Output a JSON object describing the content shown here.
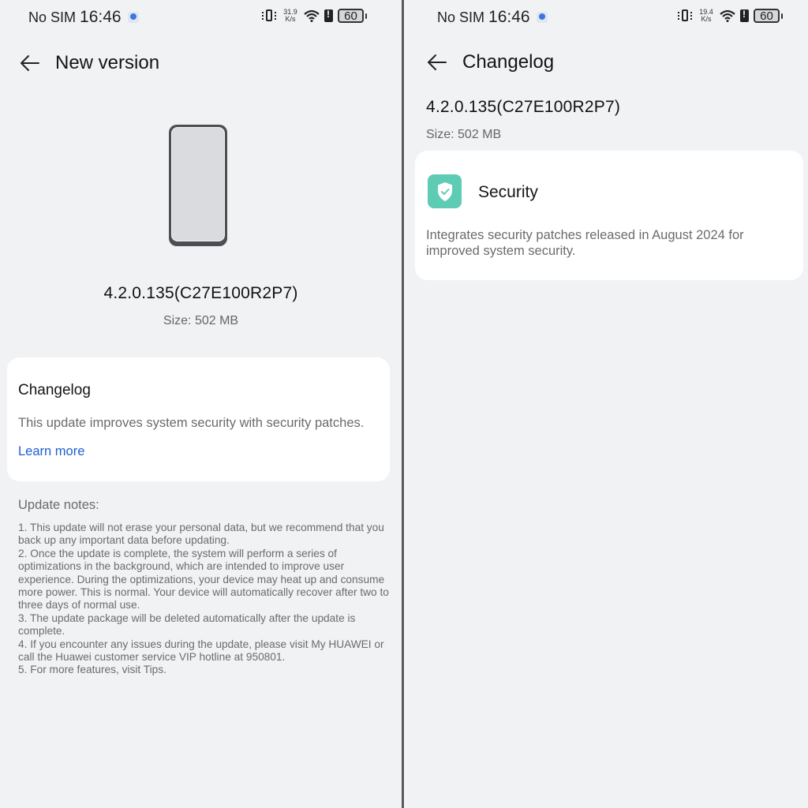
{
  "screens": {
    "left": {
      "status_bar": {
        "carrier": "No SIM",
        "time": "16:46",
        "notification_icon": "app-notification-icon",
        "vibrate_icon": "vibrate-icon",
        "net_speed_value": "31.9",
        "net_speed_unit": "K/s",
        "wifi_icon": "wifi-icon",
        "sim_alert_icon": "sim-alert-icon",
        "battery": "60"
      },
      "header": {
        "back_icon": "arrow-left-icon",
        "title": "New version"
      },
      "device_illustration": "phone-illustration",
      "version": "4.2.0.135(C27E100R2P7)",
      "size": "Size: 502 MB",
      "changelog_card": {
        "title": "Changelog",
        "description": "This update improves system security with security patches.",
        "link_label": "Learn more"
      },
      "update_notes": {
        "title": "Update notes:",
        "items": [
          "1. This update will not erase your personal data, but we recommend that you back up any important data before updating.",
          "2. Once the update is complete, the system will perform a series of optimizations in the background, which are intended to improve user experience. During the optimizations, your device may heat up and consume more power. This is normal. Your device will automatically recover after two to three days of normal use.",
          "3. The update package will be deleted automatically after the update is complete.",
          "4. If you encounter any issues during the update, please visit My HUAWEI or call the Huawei customer service VIP hotline at 950801.",
          "5. For more features, visit Tips."
        ]
      }
    },
    "right": {
      "status_bar": {
        "carrier": "No SIM",
        "time": "16:46",
        "notification_icon": "app-notification-icon",
        "vibrate_icon": "vibrate-icon",
        "net_speed_value": "19.4",
        "net_speed_unit": "K/s",
        "wifi_icon": "wifi-icon",
        "sim_alert_icon": "sim-alert-icon",
        "battery": "60"
      },
      "header": {
        "back_icon": "arrow-left-icon",
        "title": "Changelog"
      },
      "version": "4.2.0.135(C27E100R2P7)",
      "size": "Size: 502 MB",
      "security_card": {
        "icon": "shield-check-icon",
        "icon_color": "#5ecbb4",
        "title": "Security",
        "description": "Integrates security patches released in August 2024 for improved system security."
      }
    }
  },
  "colors": {
    "background": "#f1f2f4",
    "card": "#ffffff",
    "link": "#1f5fd1",
    "secondary_text": "#6b6b6d",
    "accent_security": "#5ecbb4"
  }
}
